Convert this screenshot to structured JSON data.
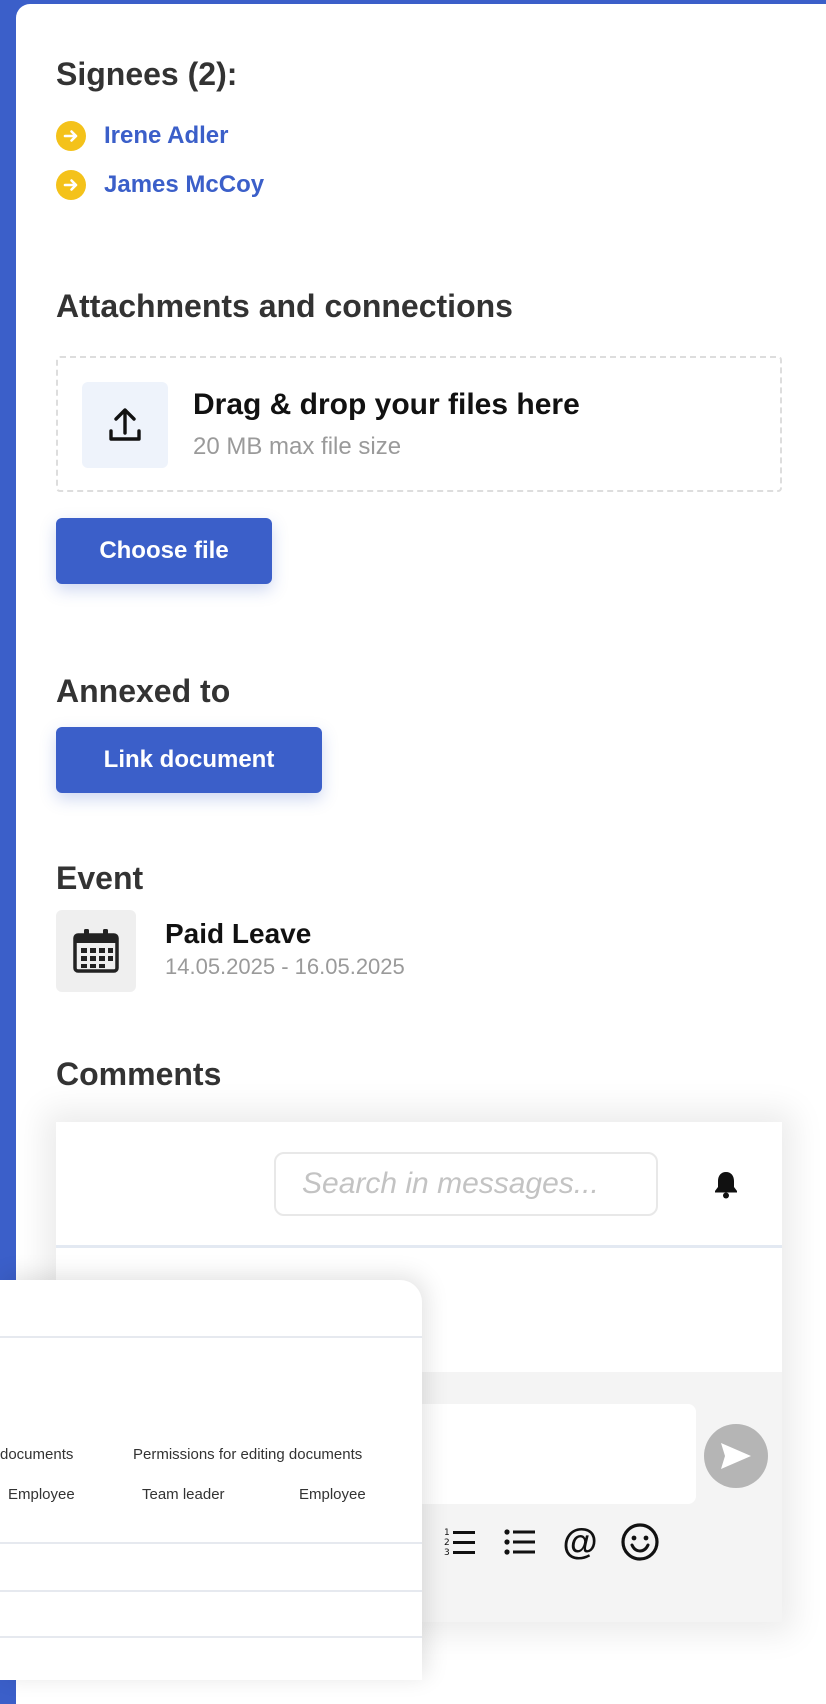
{
  "signees": {
    "heading": "Signees (2):",
    "people": [
      {
        "name": "Irene Adler"
      },
      {
        "name": "James McCoy"
      }
    ]
  },
  "attachments": {
    "heading": "Attachments and connections",
    "drop_title": "Drag & drop your files here",
    "drop_subtitle": "20 MB max file size",
    "choose_button": "Choose file"
  },
  "annexed": {
    "heading": "Annexed to",
    "link_button": "Link document"
  },
  "event": {
    "heading": "Event",
    "title": "Paid Leave",
    "dates": "14.05.2025 - 16.05.2025"
  },
  "comments": {
    "heading": "Comments",
    "search_placeholder": "Search in messages..."
  },
  "permissions_card": {
    "col_headers": [
      "documents",
      "Permissions for editing documents"
    ],
    "roles": [
      "Employee",
      "Team leader",
      "Employee"
    ]
  },
  "colors": {
    "primary": "#3b5fc9",
    "accent": "#f4c21a"
  }
}
